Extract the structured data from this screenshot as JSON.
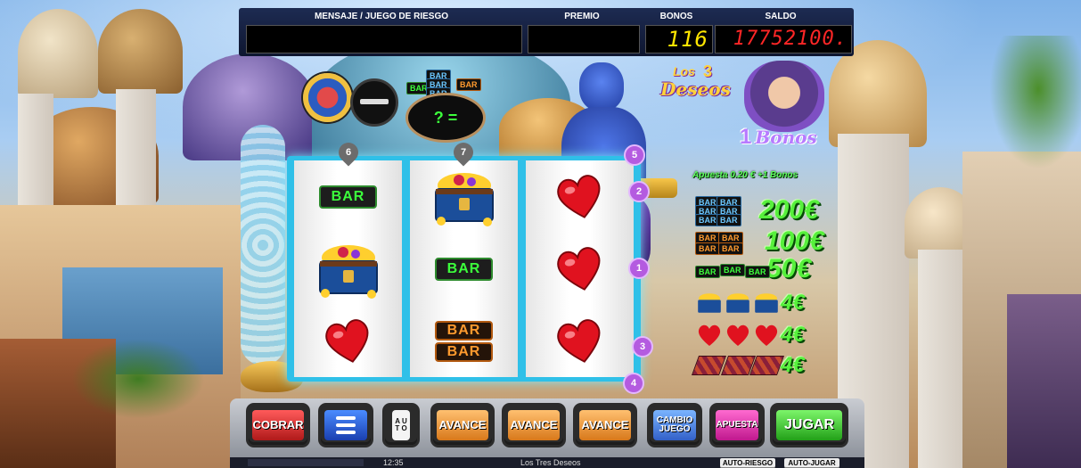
{
  "top": {
    "mensaje_label": "MENSAJE / JUEGO DE RIESGO",
    "premio_label": "PREMIO",
    "bonos_label": "BONOS",
    "saldo_label": "SALDO",
    "bonos_value": "116",
    "saldo_value": "17752100."
  },
  "logo": {
    "line1": "Los",
    "number": "3",
    "line2": "Deseos"
  },
  "bonus_counter": {
    "count": "1",
    "label": "Bonos"
  },
  "mini_game": {
    "question": "? ="
  },
  "reel_pins": [
    "6",
    "7"
  ],
  "line_markers": [
    "5",
    "2",
    "1",
    "3",
    "4"
  ],
  "reels": [
    [
      "BAR",
      "chest",
      "heart"
    ],
    [
      "chest",
      "BAR",
      "BARBAR"
    ],
    [
      "heart",
      "heart",
      "heart"
    ]
  ],
  "symbols": {
    "bar_text": "BAR"
  },
  "paytable": {
    "title": "Apuesta 0.20 € +1 Bonos",
    "rows": [
      {
        "symbol": "triple-bar",
        "value": "200€"
      },
      {
        "symbol": "double-bar",
        "value": "100€"
      },
      {
        "symbol": "single-bar",
        "value": "50€"
      },
      {
        "symbol": "chest",
        "value": "4€"
      },
      {
        "symbol": "heart",
        "value": "4€"
      },
      {
        "symbol": "carpet",
        "value": "4€"
      }
    ]
  },
  "buttons": {
    "cobrar": "COBRAR",
    "auto": "A U T O",
    "avance1": "AVANCE",
    "avance2": "AVANCE",
    "avance3": "AVANCE",
    "cambio": "CAMBIO JUEGO",
    "apuesta": "APUESTA",
    "jugar": "JUGAR"
  },
  "status": {
    "time": "12:35",
    "game_name": "Los Tres Deseos",
    "auto_riesgo": "AUTO-RIESGO",
    "auto_jugar": "AUTO-JUGAR"
  },
  "colors": {
    "led_red": "#ff2626",
    "led_yellow": "#ffe600",
    "pay_green": "#57f03c",
    "reel_frame": "#2fc0e8",
    "line_marker": "#b45be0"
  }
}
